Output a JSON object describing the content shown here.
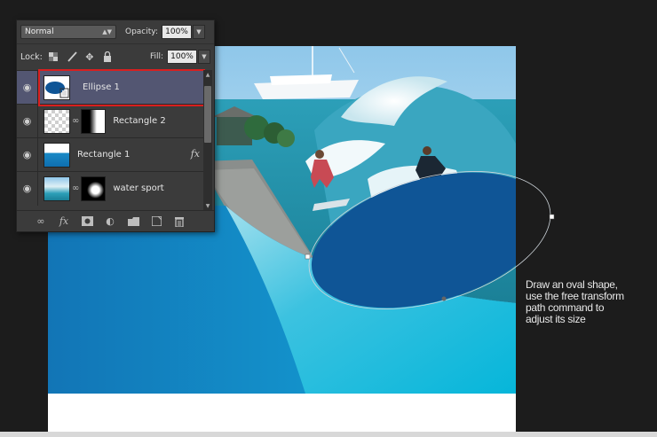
{
  "layers_panel": {
    "blend_mode": "Normal",
    "opacity_label": "Opacity:",
    "opacity_value": "100%",
    "lock_label": "Lock:",
    "fill_label": "Fill:",
    "fill_value": "100%",
    "layers": [
      {
        "name": "Ellipse 1",
        "selected": true,
        "visible": true,
        "has_mask": false,
        "fx": false
      },
      {
        "name": "Rectangle 2",
        "selected": false,
        "visible": true,
        "has_mask": true,
        "fx": false
      },
      {
        "name": "Rectangle 1",
        "selected": false,
        "visible": true,
        "has_mask": false,
        "fx": true,
        "fx_label": "fx"
      },
      {
        "name": "water sport",
        "selected": false,
        "visible": true,
        "has_mask": true,
        "fx": false
      }
    ],
    "bottom_icons": [
      "link-icon",
      "fx-icon",
      "mask-icon",
      "adjustment-icon",
      "folder-icon",
      "new-layer-icon",
      "trash-icon"
    ],
    "highlight_color": "#d81f1f"
  },
  "annotation": {
    "lines": [
      "Draw an oval shape,",
      "use the free transform",
      "path command to",
      "adjust its size"
    ]
  },
  "colors": {
    "workspace": "#1c1c1c",
    "ellipse_fill": "#0f5596",
    "bg_blue": "#1a8ac6",
    "bg_cyan": "#16b6d8"
  }
}
